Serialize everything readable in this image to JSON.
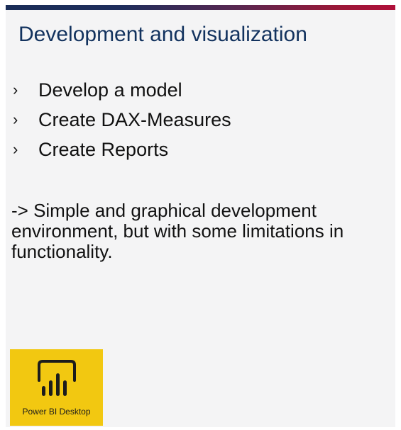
{
  "slide": {
    "title": "Development and visualization",
    "bullet_marker": "›",
    "bullets": [
      "Develop a model",
      "Create DAX-Measures",
      "Create Reports"
    ],
    "note": "-> Simple and graphical development environment, but with some limitations in functionality.",
    "accent_gradient": [
      "#1a2d57",
      "#b0103a"
    ],
    "title_color": "#12325e"
  },
  "logo": {
    "icon": "power-bi-icon",
    "label": "Power BI Desktop",
    "background_color": "#f2c811"
  }
}
